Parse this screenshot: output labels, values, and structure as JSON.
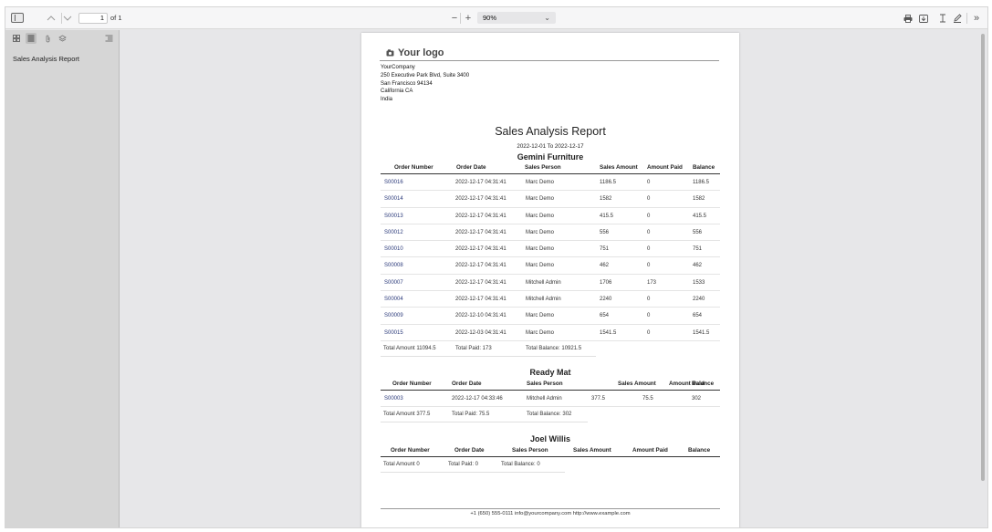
{
  "toolbar": {
    "page_current": "1",
    "page_total": "of 1",
    "zoom_out": "−",
    "zoom_in": "+",
    "zoom": "90%",
    "more": "»"
  },
  "sidebar": {
    "items": [
      {
        "label": "Sales Analysis Report"
      }
    ]
  },
  "report": {
    "logo_text": "Your logo",
    "company": {
      "name": "YourCompany",
      "street": "250 Executive Park Blvd, Suite 3400",
      "city_zip": "San Francisco 94134",
      "state": "California CA",
      "country": "India"
    },
    "title": "Sales Analysis Report",
    "date_range": "2022-12-01 To 2022-12-17",
    "columns": [
      "Order Number",
      "Order Date",
      "Sales Person",
      "Sales Amount",
      "Amount Paid",
      "Balance"
    ],
    "customers": [
      {
        "name": "Gemini Furniture",
        "rows": [
          [
            "S00016",
            "2022-12-17 04:31:41",
            "Marc Demo",
            "1186.5",
            "0",
            "1186.5"
          ],
          [
            "S00014",
            "2022-12-17 04:31:41",
            "Marc Demo",
            "1582",
            "0",
            "1582"
          ],
          [
            "S00013",
            "2022-12-17 04:31:41",
            "Marc Demo",
            "415.5",
            "0",
            "415.5"
          ],
          [
            "S00012",
            "2022-12-17 04:31:41",
            "Marc Demo",
            "556",
            "0",
            "556"
          ],
          [
            "S00010",
            "2022-12-17 04:31:41",
            "Marc Demo",
            "751",
            "0",
            "751"
          ],
          [
            "S00008",
            "2022-12-17 04:31:41",
            "Marc Demo",
            "462",
            "0",
            "462"
          ],
          [
            "S00007",
            "2022-12-17 04:31:41",
            "Mitchell Admin",
            "1706",
            "173",
            "1533"
          ],
          [
            "S00004",
            "2022-12-17 04:31:41",
            "Mitchell Admin",
            "2240",
            "0",
            "2240"
          ],
          [
            "S00009",
            "2022-12-10 04:31:41",
            "Marc Demo",
            "654",
            "0",
            "654"
          ],
          [
            "S00015",
            "2022-12-03 04:31:41",
            "Marc Demo",
            "1541.5",
            "0",
            "1541.5"
          ]
        ],
        "total_amount": "Total Amount 11094.5",
        "total_paid": "Total Paid: 173",
        "total_balance": "Total Balance: 10921.5"
      },
      {
        "name": "Ready Mat",
        "rows": [
          [
            "S00003",
            "2022-12-17 04:33:46",
            "Mitchell Admin",
            "377.5",
            "75.5",
            "302"
          ]
        ],
        "total_amount": "Total Amount 377.5",
        "total_paid": "Total Paid: 75.5",
        "total_balance": "Total Balance: 302"
      },
      {
        "name": "Joel Willis",
        "rows": [],
        "total_amount": "Total Amount 0",
        "total_paid": "Total Paid: 0",
        "total_balance": "Total Balance: 0"
      }
    ],
    "footer": "+1 (650) 555-0111 info@yourcompany.com http://www.example.com"
  }
}
